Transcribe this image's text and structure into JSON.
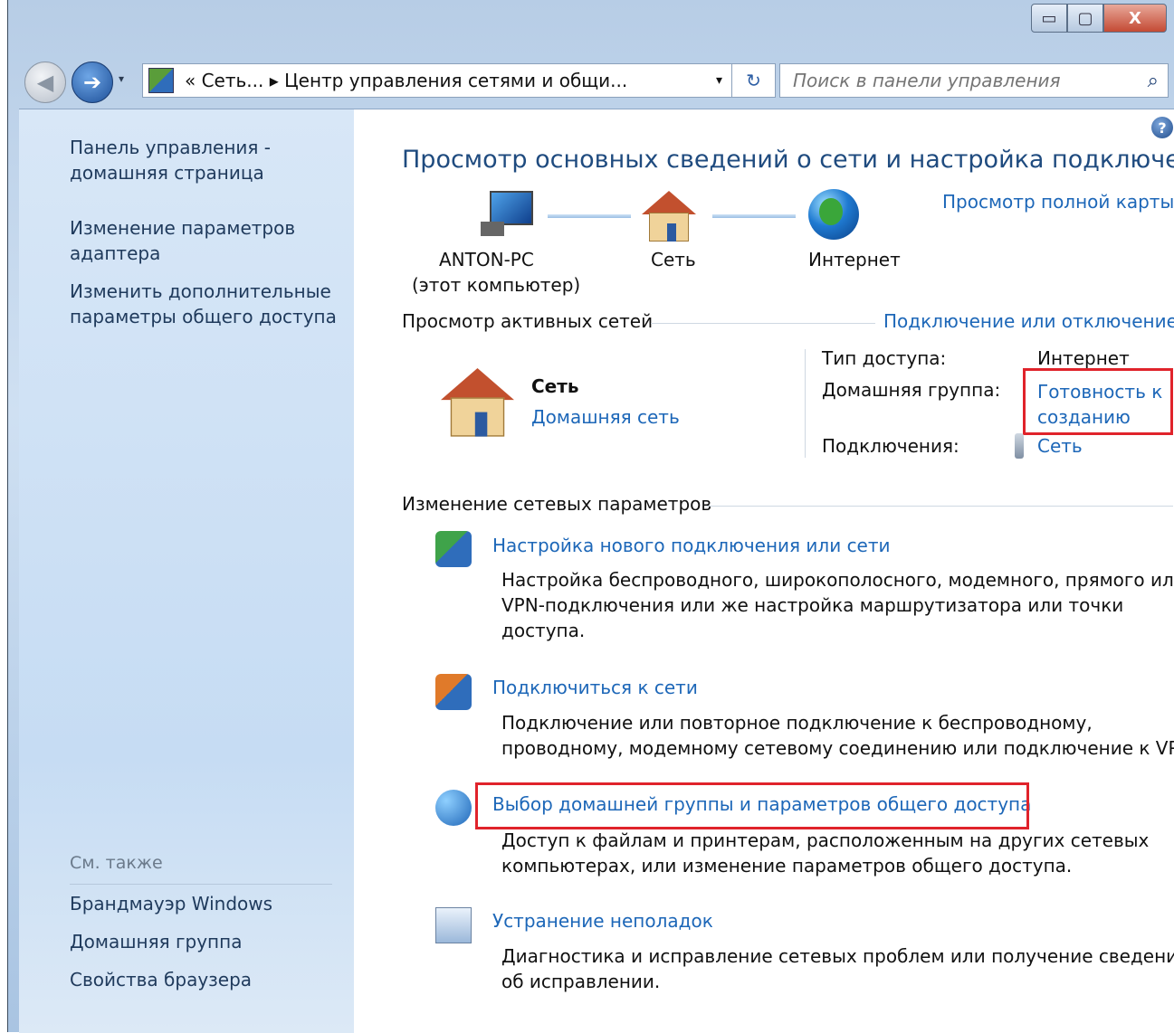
{
  "window": {
    "minimize": "▭",
    "maximize": "▢",
    "close": "X"
  },
  "nav": {
    "back_glyph": "◀",
    "forward_glyph": "➔",
    "history_glyph": "▾",
    "breadcrumb": "«  Сеть...  ▸  Центр управления сетями и общи...",
    "dropdown_glyph": "▾",
    "refresh_glyph": "↻",
    "search_placeholder": "Поиск в панели управления",
    "search_glyph": "⌕"
  },
  "sidebar": {
    "home": [
      "Панель управления -",
      "домашняя страница"
    ],
    "adapter": [
      "Изменение параметров",
      "адаптера"
    ],
    "sharing": [
      "Изменить дополнительные",
      "параметры общего доступа"
    ],
    "see_also_label": "См. также",
    "see_also": [
      "Брандмауэр Windows",
      "Домашняя группа",
      "Свойства браузера"
    ]
  },
  "main": {
    "help_glyph": "?",
    "title": "Просмотр основных сведений о сети и настройка подключений",
    "full_map_link": "Просмотр полной карты",
    "map": {
      "computer_name": "ANTON-PC",
      "computer_sub": "(этот компьютер)",
      "network": "Сеть",
      "internet": "Интернет"
    },
    "active": {
      "header": "Просмотр активных сетей",
      "connect_link": "Подключение или отключение",
      "network_name": "Сеть",
      "network_type_link": "Домашняя сеть",
      "access_label": "Тип доступа:",
      "access_value": "Интернет",
      "homegroup_label": "Домашняя группа:",
      "homegroup_value": [
        "Готовность к",
        "созданию"
      ],
      "connections_label": "Подключения:",
      "connections_value": "Сеть"
    },
    "change": {
      "header": "Изменение сетевых параметров",
      "tasks": [
        {
          "title": "Настройка нового подключения или сети",
          "desc": [
            "Настройка беспроводного, широкополосного, модемного, прямого или",
            "VPN-подключения или же настройка маршрутизатора или точки",
            "доступа."
          ]
        },
        {
          "title": "Подключиться к сети",
          "desc": [
            "Подключение или повторное подключение к беспроводному,",
            "проводному, модемному сетевому соединению или подключение к VPN."
          ]
        },
        {
          "title": "Выбор домашней группы и параметров общего доступа",
          "desc": [
            "Доступ к файлам и принтерам, расположенным на других сетевых",
            "компьютерах, или изменение параметров общего доступа."
          ]
        },
        {
          "title": "Устранение неполадок",
          "desc": [
            "Диагностика и исправление сетевых проблем или получение сведений",
            "об исправлении."
          ]
        }
      ]
    }
  }
}
